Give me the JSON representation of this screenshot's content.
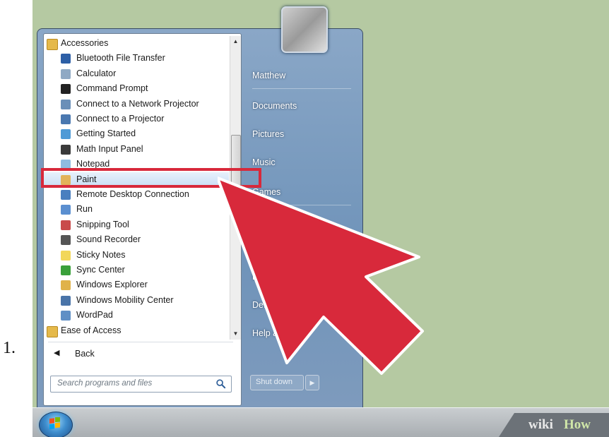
{
  "step_number": "1.",
  "watermark": {
    "part1": "wiki",
    "part2": "How"
  },
  "programs": [
    {
      "label": "Accessories",
      "type": "folder",
      "icon": "folder-icon"
    },
    {
      "label": "Bluetooth File Transfer",
      "type": "sub",
      "icon": "bluetooth-icon"
    },
    {
      "label": "Calculator",
      "type": "sub",
      "icon": "calculator-icon"
    },
    {
      "label": "Command Prompt",
      "type": "sub",
      "icon": "command-prompt-icon"
    },
    {
      "label": "Connect to a Network Projector",
      "type": "sub",
      "icon": "network-projector-icon"
    },
    {
      "label": "Connect to a Projector",
      "type": "sub",
      "icon": "projector-icon"
    },
    {
      "label": "Getting Started",
      "type": "sub",
      "icon": "getting-started-icon"
    },
    {
      "label": "Math Input Panel",
      "type": "sub",
      "icon": "math-input-icon"
    },
    {
      "label": "Notepad",
      "type": "sub",
      "icon": "notepad-icon"
    },
    {
      "label": "Paint",
      "type": "sub",
      "icon": "paint-icon",
      "selected": true
    },
    {
      "label": "Remote Desktop Connection",
      "type": "sub",
      "icon": "remote-desktop-icon"
    },
    {
      "label": "Run",
      "type": "sub",
      "icon": "run-icon"
    },
    {
      "label": "Snipping Tool",
      "type": "sub",
      "icon": "scissors-icon"
    },
    {
      "label": "Sound Recorder",
      "type": "sub",
      "icon": "microphone-icon"
    },
    {
      "label": "Sticky Notes",
      "type": "sub",
      "icon": "sticky-notes-icon"
    },
    {
      "label": "Sync Center",
      "type": "sub",
      "icon": "sync-icon"
    },
    {
      "label": "Windows Explorer",
      "type": "sub",
      "icon": "explorer-folder-icon"
    },
    {
      "label": "Windows Mobility Center",
      "type": "sub",
      "icon": "mobility-center-icon"
    },
    {
      "label": "WordPad",
      "type": "sub",
      "icon": "wordpad-icon"
    },
    {
      "label": "Ease of Access",
      "type": "folder",
      "icon": "folder-icon"
    }
  ],
  "back_label": "Back",
  "search": {
    "placeholder": "Search programs and files"
  },
  "right_items": [
    {
      "label": "Matthew"
    },
    {
      "label": "Documents"
    },
    {
      "label": "Pictures"
    },
    {
      "label": "Music"
    },
    {
      "label": "Games"
    },
    {
      "label": "L"
    },
    {
      "label": "Def"
    },
    {
      "label": "Help a"
    }
  ],
  "shutdown_label": "Shut down",
  "colors": {
    "highlight": "#d8293b",
    "arrow": "#d8293b",
    "desktop": "#b5c9a2"
  }
}
